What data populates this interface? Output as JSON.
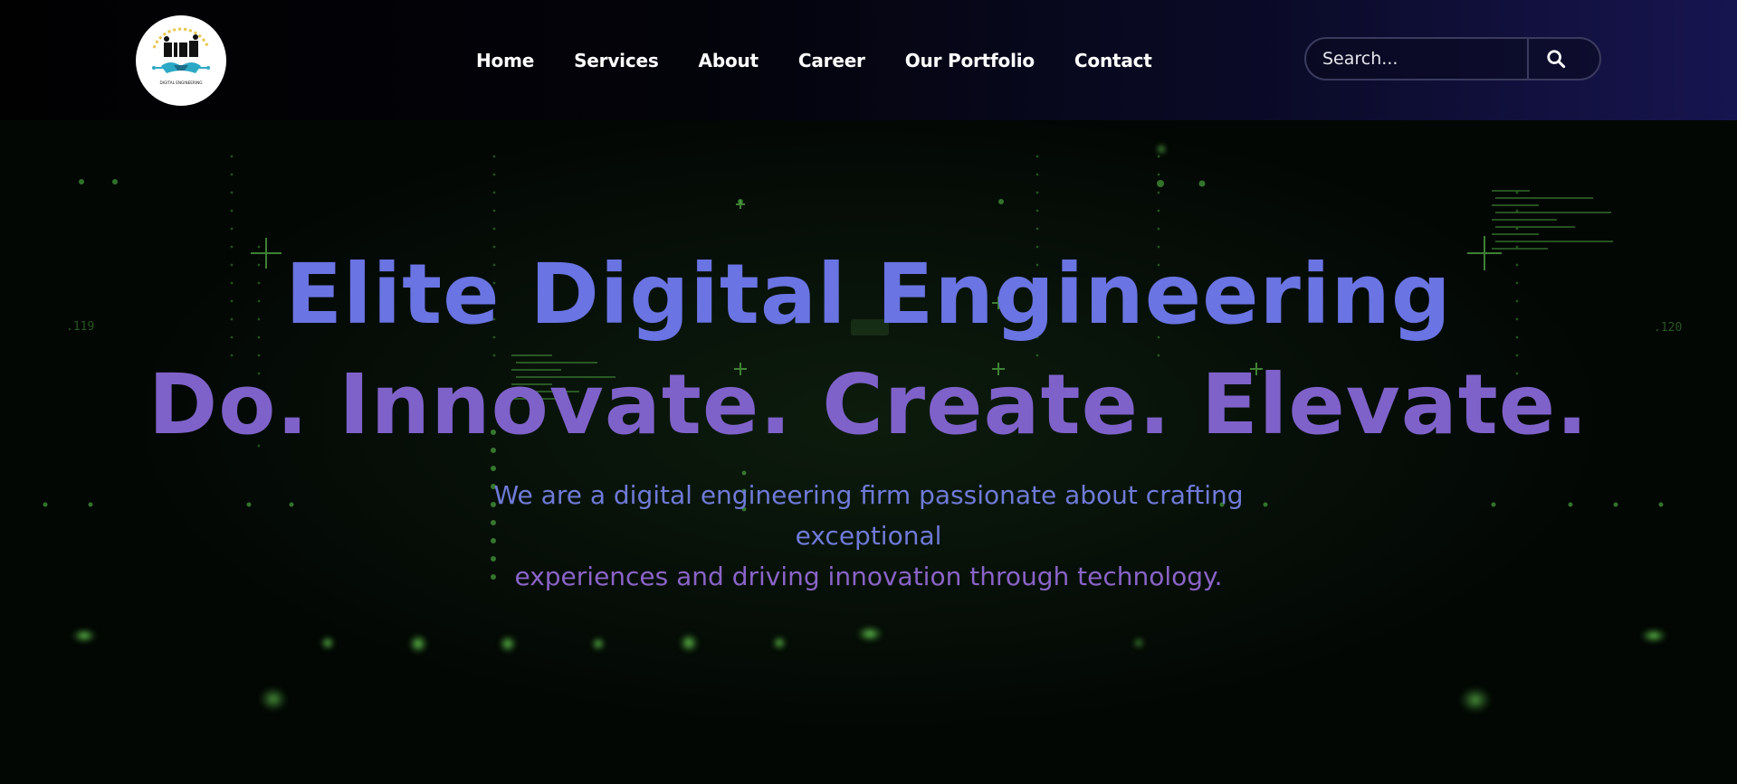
{
  "logo": {
    "alt": "Elite Digital Engineering logo",
    "caption": "DIGITAL ENGINEERING"
  },
  "nav": {
    "items": [
      {
        "label": "Home"
      },
      {
        "label": "Services"
      },
      {
        "label": "About"
      },
      {
        "label": "Career"
      },
      {
        "label": "Our Portfolio"
      },
      {
        "label": "Contact"
      }
    ]
  },
  "search": {
    "placeholder": "Search...",
    "icon": "search-icon"
  },
  "hero": {
    "title_line1": "Elite Digital Engineering",
    "title_line2": "Do. Innovate. Create. Elevate.",
    "subtitle_line1": "We are a digital engineering firm passionate about crafting exceptional",
    "subtitle_line2": "experiences and driving innovation through technology."
  },
  "colors": {
    "title_top": "#6a74e2",
    "title_bottom": "#7f62c9",
    "accent_green": "#6ee05a",
    "navbar_end": "#171550"
  }
}
